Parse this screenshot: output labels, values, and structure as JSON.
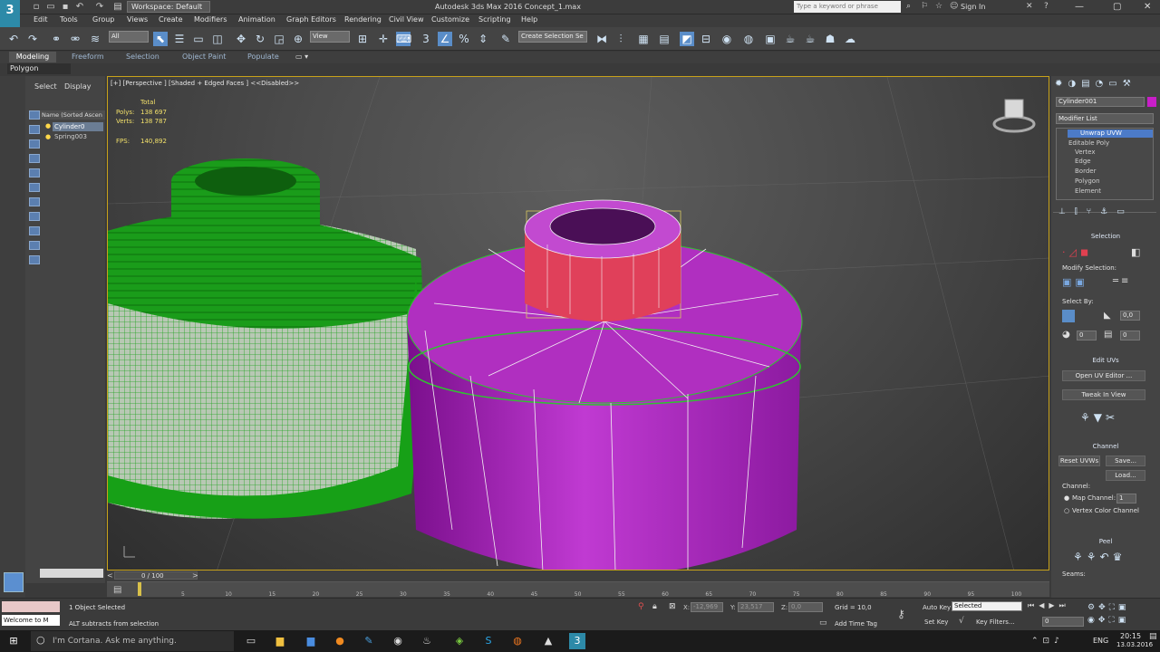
{
  "titlebar": {
    "app_title": "Autodesk 3ds Max 2016     Concept_1.max",
    "workspace": "Workspace: Default",
    "search_placeholder": "Type a keyword or phrase",
    "sign_in": "Sign In"
  },
  "menu": [
    "Edit",
    "Tools",
    "Group",
    "Views",
    "Create",
    "Modifiers",
    "Animation",
    "Graph Editors",
    "Rendering",
    "Civil View",
    "Customize",
    "Scripting",
    "Help"
  ],
  "toolbar": {
    "selection_filter": "All",
    "ref_coord": "View",
    "named_selection": "Create Selection Se"
  },
  "ribbon": {
    "tabs": [
      "Modeling",
      "Freeform",
      "Selection",
      "Object Paint",
      "Populate"
    ],
    "panel_label": "Polygon Modeling"
  },
  "scene_explorer": {
    "tabs": [
      "Select",
      "Display"
    ],
    "header": "Name (Sorted Ascen",
    "items": [
      "Cylinder0",
      "Spring003"
    ]
  },
  "viewport": {
    "label": "[+] [Perspective ] [Shaded + Edged Faces ] <<Disabled>>",
    "stats_total": "Total",
    "polys_label": "Polys:",
    "polys_value": "138 697",
    "verts_label": "Verts:",
    "verts_value": "138 787",
    "fps_label": "FPS:",
    "fps_value": "140,892"
  },
  "command_panel": {
    "object_name": "Cylinder001",
    "modifier_list": "Modifier List",
    "stack": [
      "Unwrap UVW",
      "Editable Poly",
      "Vertex",
      "Edge",
      "Border",
      "Polygon",
      "Element"
    ],
    "selection_header": "Selection",
    "modify_selection": "Modify Selection:",
    "select_by": "Select By:",
    "angle_value": "0,0",
    "spin_a": "0",
    "spin_b": "0",
    "edit_uvs_header": "Edit UVs",
    "open_uv_editor": "Open UV Editor ...",
    "tweak_in_view": "Tweak In View",
    "channel_header": "Channel",
    "reset_uvws": "Reset UVWs",
    "save": "Save...",
    "load": "Load...",
    "channel_label": "Channel:",
    "map_channel": "Map Channel:",
    "map_channel_value": "1",
    "vertex_color_channel": "Vertex Color Channel",
    "peel_header": "Peel",
    "seams": "Seams:"
  },
  "timeline": {
    "frame_counter": "0 / 100",
    "ticks": [
      "5",
      "10",
      "15",
      "20",
      "25",
      "30",
      "35",
      "40",
      "45",
      "50",
      "55",
      "60",
      "65",
      "70",
      "75",
      "80",
      "85",
      "90",
      "95",
      "100"
    ]
  },
  "statusbar": {
    "maxscript_input": "Welcome to M",
    "selected": "1 Object Selected",
    "prompt": "ALT subtracts from selection",
    "x_label": "X:",
    "x_value": "-12,969",
    "y_label": "Y:",
    "y_value": "23,517",
    "z_label": "Z:",
    "z_value": "0,0",
    "grid": "Grid = 10,0",
    "add_time_tag": "Add Time Tag",
    "auto_key": "Auto Key",
    "set_key": "Set Key",
    "selected_dropdown": "Selected",
    "key_filters": "Key Filters...",
    "frame_value": "0"
  },
  "taskbar": {
    "cortana": "I'm Cortana. Ask me anything.",
    "language": "ENG",
    "time": "20:15",
    "date": "13.03.2016"
  },
  "colors": {
    "accent": "#5a8dc8",
    "viewport_border": "#c8a21a",
    "green_object": "#1fa31f",
    "purple_object": "#b21fc4",
    "selected_polys": "#e0405a"
  }
}
